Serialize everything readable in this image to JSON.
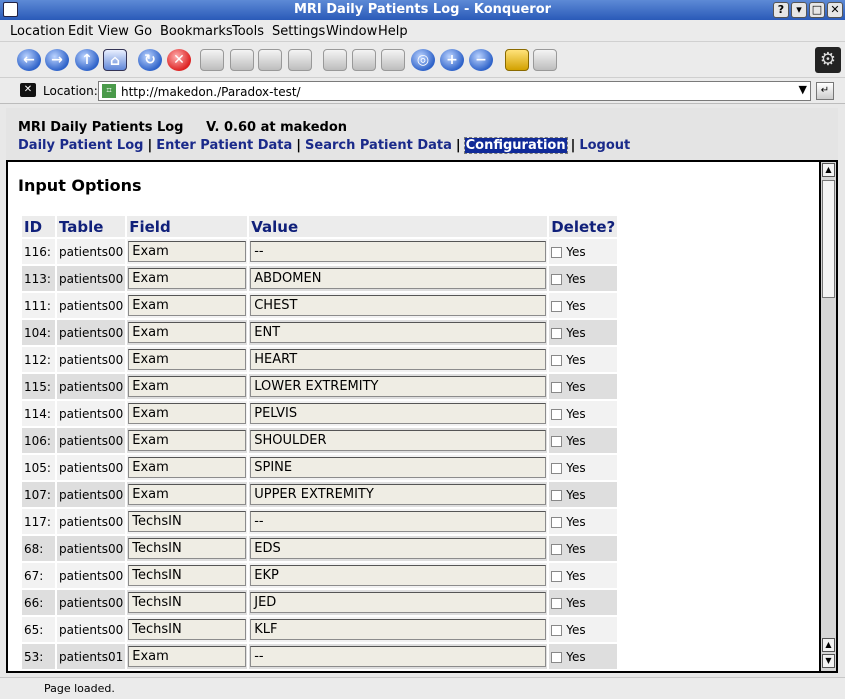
{
  "window": {
    "title": "MRI Daily Patients Log - Konqueror"
  },
  "menu": [
    "Location",
    "Edit",
    "View",
    "Go",
    "Bookmarks",
    "Tools",
    "Settings",
    "Window",
    "Help"
  ],
  "location": {
    "label": "Location:",
    "url": "http://makedon./Paradox-test/"
  },
  "page": {
    "header_title": "MRI Daily Patients Log",
    "version": "V. 0.60 at makedon",
    "nav": [
      "Daily Patient Log",
      "Enter Patient Data",
      "Search Patient Data",
      "Configuration",
      "Logout"
    ],
    "section_title": "Input Options"
  },
  "table": {
    "headers": [
      "ID",
      "Table",
      "Field",
      "Value",
      "Delete?"
    ],
    "delete_label": "Yes",
    "rows": [
      {
        "id": "116:",
        "table": "patients00",
        "field": "Exam",
        "value": "--"
      },
      {
        "id": "113:",
        "table": "patients00",
        "field": "Exam",
        "value": "ABDOMEN"
      },
      {
        "id": "111:",
        "table": "patients00",
        "field": "Exam",
        "value": "CHEST"
      },
      {
        "id": "104:",
        "table": "patients00",
        "field": "Exam",
        "value": "ENT"
      },
      {
        "id": "112:",
        "table": "patients00",
        "field": "Exam",
        "value": "HEART"
      },
      {
        "id": "115:",
        "table": "patients00",
        "field": "Exam",
        "value": "LOWER EXTREMITY"
      },
      {
        "id": "114:",
        "table": "patients00",
        "field": "Exam",
        "value": "PELVIS"
      },
      {
        "id": "106:",
        "table": "patients00",
        "field": "Exam",
        "value": "SHOULDER"
      },
      {
        "id": "105:",
        "table": "patients00",
        "field": "Exam",
        "value": "SPINE"
      },
      {
        "id": "107:",
        "table": "patients00",
        "field": "Exam",
        "value": "UPPER EXTREMITY"
      },
      {
        "id": "117:",
        "table": "patients00",
        "field": "TechsIN",
        "value": "--"
      },
      {
        "id": "68:",
        "table": "patients00",
        "field": "TechsIN",
        "value": "EDS"
      },
      {
        "id": "67:",
        "table": "patients00",
        "field": "TechsIN",
        "value": "EKP"
      },
      {
        "id": "66:",
        "table": "patients00",
        "field": "TechsIN",
        "value": "JED"
      },
      {
        "id": "65:",
        "table": "patients00",
        "field": "TechsIN",
        "value": "KLF"
      },
      {
        "id": "53:",
        "table": "patients01",
        "field": "Exam",
        "value": "--"
      }
    ]
  },
  "status": {
    "text": "Page loaded."
  }
}
